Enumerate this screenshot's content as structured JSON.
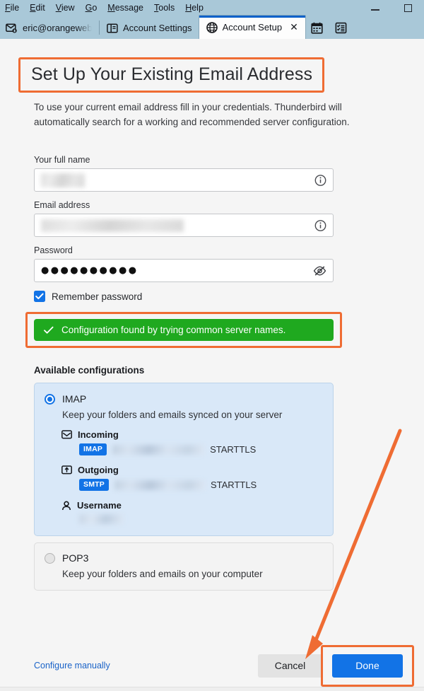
{
  "window": {
    "menu_items": [
      {
        "label": "File",
        "accesskey": "F"
      },
      {
        "label": "Edit",
        "accesskey": "E"
      },
      {
        "label": "View",
        "accesskey": "V"
      },
      {
        "label": "Go",
        "accesskey": "G"
      },
      {
        "label": "Message",
        "accesskey": "M"
      },
      {
        "label": "Tools",
        "accesskey": "T"
      },
      {
        "label": "Help",
        "accesskey": "H"
      }
    ],
    "controls": {
      "minimize": "—",
      "maximize": "□"
    },
    "titlebar_color": "#a9c8d8"
  },
  "tabs": [
    {
      "label": "eric@orangewebs",
      "icon": "mail-account-icon",
      "active": false,
      "closable": false
    },
    {
      "label": "Account Settings",
      "icon": "account-settings-icon",
      "active": false,
      "closable": false
    },
    {
      "label": "Account Setup",
      "icon": "globe-icon",
      "active": true,
      "closable": true,
      "close_label": "✕"
    }
  ],
  "toolbar_buttons": [
    {
      "name": "calendar-button",
      "icon": "calendar-icon"
    },
    {
      "name": "tasks-button",
      "icon": "tasks-icon"
    }
  ],
  "main": {
    "title": "Set Up Your Existing Email Address",
    "description": "To use your current email address fill in your credentials. Thunderbird will automatically search for a working and recommended server configuration.",
    "fields": [
      {
        "label": "Your full name",
        "value": "",
        "redacted": true,
        "trailing_icon": "info-icon"
      },
      {
        "label": "Email address",
        "value": "",
        "redacted": true,
        "trailing_icon": "info-icon"
      },
      {
        "label": "Password",
        "value": "●●●●●●●●●●",
        "redacted": false,
        "trailing_icon": "eye-slash-icon"
      }
    ],
    "remember_password": {
      "label": "Remember password",
      "checked": true
    },
    "notification": {
      "text": "Configuration found by trying common server names.",
      "icon": "check-icon",
      "color": "#1fa91f",
      "highlighted": true
    },
    "configurations_heading": "Available configurations",
    "configurations": [
      {
        "name": "IMAP",
        "selected": true,
        "description": "Keep your folders and emails synced on your server",
        "details": [
          {
            "label": "Incoming",
            "icon": "inbox-icon",
            "protocol": "IMAP",
            "host": "",
            "host_redacted": true,
            "security": "STARTTLS"
          },
          {
            "label": "Outgoing",
            "icon": "outbox-icon",
            "protocol": "SMTP",
            "host": "",
            "host_redacted": true,
            "security": "STARTTLS"
          },
          {
            "label": "Username",
            "icon": "person-icon",
            "value": "",
            "value_redacted": true
          }
        ]
      },
      {
        "name": "POP3",
        "selected": false,
        "description": "Keep your folders and emails on your computer",
        "details": []
      }
    ]
  },
  "footer": {
    "configure_manually_label": "Configure manually",
    "cancel_label": "Cancel",
    "done_label": "Done",
    "done_highlighted": true
  },
  "annotations": {
    "color": "#ef6c33",
    "boxes": [
      "page-title",
      "notification",
      "done-button"
    ],
    "arrow": {
      "from": "top-right",
      "to": "done-button"
    }
  }
}
